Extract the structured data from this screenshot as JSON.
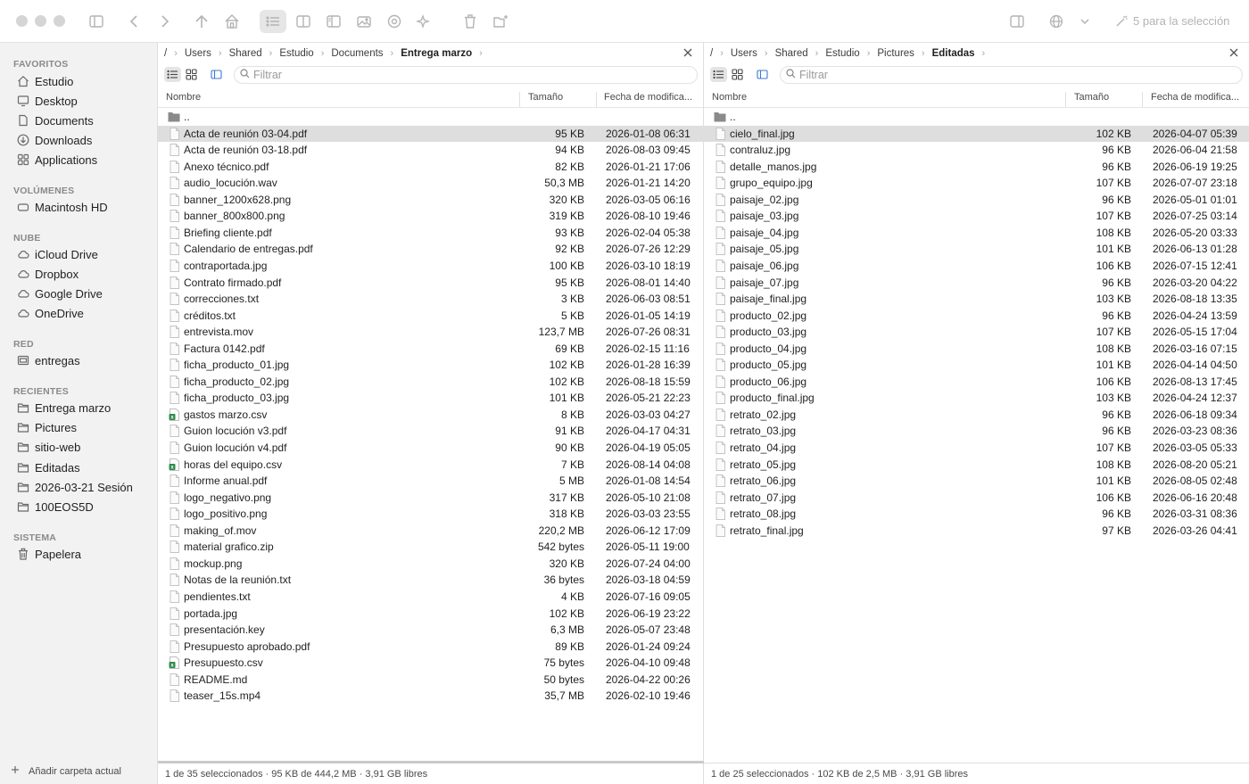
{
  "toolbar": {
    "selection_label": "5 para la selección"
  },
  "sidebar": {
    "sections": [
      {
        "title": "FAVORITOS",
        "items": [
          {
            "label": "Estudio",
            "icon": "home-icon"
          },
          {
            "label": "Desktop",
            "icon": "desktop-icon"
          },
          {
            "label": "Documents",
            "icon": "document-icon"
          },
          {
            "label": "Downloads",
            "icon": "download-icon"
          },
          {
            "label": "Applications",
            "icon": "applications-icon"
          }
        ]
      },
      {
        "title": "VOLÚMENES",
        "items": [
          {
            "label": "Macintosh HD",
            "icon": "disk-icon"
          }
        ]
      },
      {
        "title": "NUBE",
        "items": [
          {
            "label": "iCloud Drive",
            "icon": "cloud-icon"
          },
          {
            "label": "Dropbox",
            "icon": "cloud-icon"
          },
          {
            "label": "Google Drive",
            "icon": "cloud-icon"
          },
          {
            "label": "OneDrive",
            "icon": "cloud-icon"
          }
        ]
      },
      {
        "title": "RED",
        "items": [
          {
            "label": "entregas",
            "icon": "network-drive-icon"
          }
        ]
      },
      {
        "title": "RECIENTES",
        "items": [
          {
            "label": "Entrega marzo",
            "icon": "folder-icon"
          },
          {
            "label": "Pictures",
            "icon": "folder-icon"
          },
          {
            "label": "sitio-web",
            "icon": "folder-icon"
          },
          {
            "label": "Editadas",
            "icon": "folder-icon"
          },
          {
            "label": "2026-03-21 Sesión",
            "icon": "folder-icon"
          },
          {
            "label": "100EOS5D",
            "icon": "folder-icon"
          }
        ]
      },
      {
        "title": "SISTEMA",
        "items": [
          {
            "label": "Papelera",
            "icon": "trash-icon"
          }
        ]
      }
    ],
    "footer_label": "Añadir carpeta actual"
  },
  "panes": [
    {
      "breadcrumb": [
        "/",
        "Users",
        "Shared",
        "Estudio",
        "Documents",
        "Entrega marzo"
      ],
      "filter_placeholder": "Filtrar",
      "columns": {
        "name": "Nombre",
        "size": "Tamaño",
        "date": "Fecha de modifica..."
      },
      "parent": "..",
      "status": "1 de 35 seleccionados · 95 KB de 444,2 MB · 3,91 GB libres",
      "selected_index": 0,
      "files": [
        {
          "name": "Acta de reunión 03-04.pdf",
          "size": "95 KB",
          "date": "2026-01-08 06:31"
        },
        {
          "name": "Acta de reunión 03-18.pdf",
          "size": "94 KB",
          "date": "2026-08-03 09:45"
        },
        {
          "name": "Anexo técnico.pdf",
          "size": "82 KB",
          "date": "2026-01-21 17:06"
        },
        {
          "name": "audio_locución.wav",
          "size": "50,3 MB",
          "date": "2026-01-21 14:20"
        },
        {
          "name": "banner_1200x628.png",
          "size": "320 KB",
          "date": "2026-03-05 06:16"
        },
        {
          "name": "banner_800x800.png",
          "size": "319 KB",
          "date": "2026-08-10 19:46"
        },
        {
          "name": "Briefing cliente.pdf",
          "size": "93 KB",
          "date": "2026-02-04 05:38"
        },
        {
          "name": "Calendario de entregas.pdf",
          "size": "92 KB",
          "date": "2026-07-26 12:29"
        },
        {
          "name": "contraportada.jpg",
          "size": "100 KB",
          "date": "2026-03-10 18:19"
        },
        {
          "name": "Contrato firmado.pdf",
          "size": "95 KB",
          "date": "2026-08-01 14:40"
        },
        {
          "name": "correcciones.txt",
          "size": "3 KB",
          "date": "2026-06-03 08:51"
        },
        {
          "name": "créditos.txt",
          "size": "5 KB",
          "date": "2026-01-05 14:19"
        },
        {
          "name": "entrevista.mov",
          "size": "123,7 MB",
          "date": "2026-07-26 08:31"
        },
        {
          "name": "Factura 0142.pdf",
          "size": "69 KB",
          "date": "2026-02-15 11:16"
        },
        {
          "name": "ficha_producto_01.jpg",
          "size": "102 KB",
          "date": "2026-01-28 16:39"
        },
        {
          "name": "ficha_producto_02.jpg",
          "size": "102 KB",
          "date": "2026-08-18 15:59"
        },
        {
          "name": "ficha_producto_03.jpg",
          "size": "101 KB",
          "date": "2026-05-21 22:23"
        },
        {
          "name": "gastos marzo.csv",
          "size": "8 KB",
          "date": "2026-03-03 04:27",
          "type": "csv"
        },
        {
          "name": "Guion locución v3.pdf",
          "size": "91 KB",
          "date": "2026-04-17 04:31"
        },
        {
          "name": "Guion locución v4.pdf",
          "size": "90 KB",
          "date": "2026-04-19 05:05"
        },
        {
          "name": "horas del equipo.csv",
          "size": "7 KB",
          "date": "2026-08-14 04:08",
          "type": "csv"
        },
        {
          "name": "Informe anual.pdf",
          "size": "5 MB",
          "date": "2026-01-08 14:54"
        },
        {
          "name": "logo_negativo.png",
          "size": "317 KB",
          "date": "2026-05-10 21:08"
        },
        {
          "name": "logo_positivo.png",
          "size": "318 KB",
          "date": "2026-03-03 23:55"
        },
        {
          "name": "making_of.mov",
          "size": "220,2 MB",
          "date": "2026-06-12 17:09"
        },
        {
          "name": "material grafico.zip",
          "size": "542 bytes",
          "date": "2026-05-11 19:00"
        },
        {
          "name": "mockup.png",
          "size": "320 KB",
          "date": "2026-07-24 04:00"
        },
        {
          "name": "Notas de la reunión.txt",
          "size": "36 bytes",
          "date": "2026-03-18 04:59"
        },
        {
          "name": "pendientes.txt",
          "size": "4 KB",
          "date": "2026-07-16 09:05"
        },
        {
          "name": "portada.jpg",
          "size": "102 KB",
          "date": "2026-06-19 23:22"
        },
        {
          "name": "presentación.key",
          "size": "6,3 MB",
          "date": "2026-05-07 23:48"
        },
        {
          "name": "Presupuesto aprobado.pdf",
          "size": "89 KB",
          "date": "2026-01-24 09:24"
        },
        {
          "name": "Presupuesto.csv",
          "size": "75 bytes",
          "date": "2026-04-10 09:48",
          "type": "csv"
        },
        {
          "name": "README.md",
          "size": "50 bytes",
          "date": "2026-04-22 00:26"
        },
        {
          "name": "teaser_15s.mp4",
          "size": "35,7 MB",
          "date": "2026-02-10 19:46"
        }
      ]
    },
    {
      "breadcrumb": [
        "/",
        "Users",
        "Shared",
        "Estudio",
        "Pictures",
        "Editadas"
      ],
      "filter_placeholder": "Filtrar",
      "columns": {
        "name": "Nombre",
        "size": "Tamaño",
        "date": "Fecha de modifica..."
      },
      "parent": "..",
      "status": "1 de 25 seleccionados · 102 KB de 2,5 MB · 3,91 GB libres",
      "selected_index": 0,
      "files": [
        {
          "name": "cielo_final.jpg",
          "size": "102 KB",
          "date": "2026-04-07 05:39"
        },
        {
          "name": "contraluz.jpg",
          "size": "96 KB",
          "date": "2026-06-04 21:58"
        },
        {
          "name": "detalle_manos.jpg",
          "size": "96 KB",
          "date": "2026-06-19 19:25"
        },
        {
          "name": "grupo_equipo.jpg",
          "size": "107 KB",
          "date": "2026-07-07 23:18"
        },
        {
          "name": "paisaje_02.jpg",
          "size": "96 KB",
          "date": "2026-05-01 01:01"
        },
        {
          "name": "paisaje_03.jpg",
          "size": "107 KB",
          "date": "2026-07-25 03:14"
        },
        {
          "name": "paisaje_04.jpg",
          "size": "108 KB",
          "date": "2026-05-20 03:33"
        },
        {
          "name": "paisaje_05.jpg",
          "size": "101 KB",
          "date": "2026-06-13 01:28"
        },
        {
          "name": "paisaje_06.jpg",
          "size": "106 KB",
          "date": "2026-07-15 12:41"
        },
        {
          "name": "paisaje_07.jpg",
          "size": "96 KB",
          "date": "2026-03-20 04:22"
        },
        {
          "name": "paisaje_final.jpg",
          "size": "103 KB",
          "date": "2026-08-18 13:35"
        },
        {
          "name": "producto_02.jpg",
          "size": "96 KB",
          "date": "2026-04-24 13:59"
        },
        {
          "name": "producto_03.jpg",
          "size": "107 KB",
          "date": "2026-05-15 17:04"
        },
        {
          "name": "producto_04.jpg",
          "size": "108 KB",
          "date": "2026-03-16 07:15"
        },
        {
          "name": "producto_05.jpg",
          "size": "101 KB",
          "date": "2026-04-14 04:50"
        },
        {
          "name": "producto_06.jpg",
          "size": "106 KB",
          "date": "2026-08-13 17:45"
        },
        {
          "name": "producto_final.jpg",
          "size": "103 KB",
          "date": "2026-04-24 12:37"
        },
        {
          "name": "retrato_02.jpg",
          "size": "96 KB",
          "date": "2026-06-18 09:34"
        },
        {
          "name": "retrato_03.jpg",
          "size": "96 KB",
          "date": "2026-03-23 08:36"
        },
        {
          "name": "retrato_04.jpg",
          "size": "107 KB",
          "date": "2026-03-05 05:33"
        },
        {
          "name": "retrato_05.jpg",
          "size": "108 KB",
          "date": "2026-08-20 05:21"
        },
        {
          "name": "retrato_06.jpg",
          "size": "101 KB",
          "date": "2026-08-05 02:48"
        },
        {
          "name": "retrato_07.jpg",
          "size": "106 KB",
          "date": "2026-06-16 20:48"
        },
        {
          "name": "retrato_08.jpg",
          "size": "96 KB",
          "date": "2026-03-31 08:36"
        },
        {
          "name": "retrato_final.jpg",
          "size": "97 KB",
          "date": "2026-03-26 04:41"
        }
      ]
    }
  ]
}
